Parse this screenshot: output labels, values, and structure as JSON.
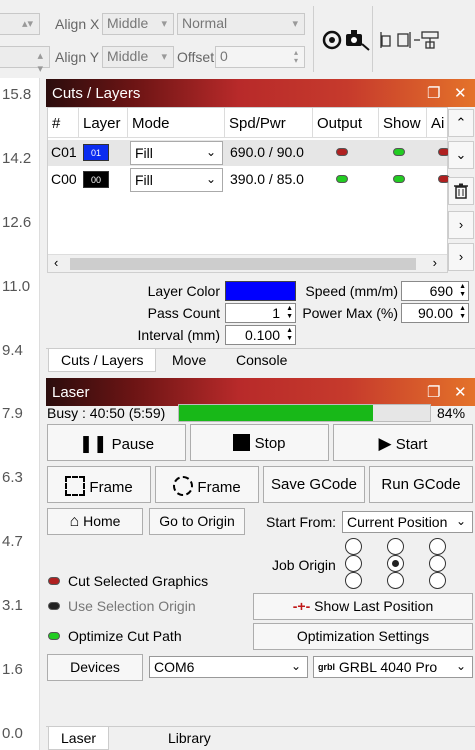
{
  "toolbar": {
    "align_x_label": "Align X",
    "align_x_value": "Middle",
    "align_x_mode": "Normal",
    "align_y_label": "Align Y",
    "align_y_value": "Middle",
    "offset_label": "Offset",
    "offset_value": "0"
  },
  "ruler": {
    "labels": [
      "15.8",
      "14.2",
      "12.6",
      "11.0",
      "9.4",
      "7.9",
      "6.3",
      "4.7",
      "3.1",
      "1.6",
      "0.0"
    ]
  },
  "cuts_panel": {
    "title": "Cuts / Layers",
    "columns": [
      "#",
      "Layer",
      "Mode",
      "Spd/Pwr",
      "Output",
      "Show",
      "Ai"
    ],
    "rows": [
      {
        "id": "C01",
        "layer": "01",
        "layer_color": "#0a2cf0",
        "mode": "Fill",
        "spd_pwr": "690.0 / 90.0",
        "output_color": "#b02020",
        "show_color": "#22cc22",
        "air_color": "#b02020"
      },
      {
        "id": "C00",
        "layer": "00",
        "layer_color": "#000000",
        "mode": "Fill",
        "spd_pwr": "390.0 / 85.0",
        "output_color": "#22cc22",
        "show_color": "#22cc22",
        "air_color": "#b02020"
      }
    ],
    "layer_color_label": "Layer Color",
    "layer_color_value": "#0000ff",
    "speed_label": "Speed (mm/m)",
    "speed_value": "690",
    "pass_count_label": "Pass Count",
    "pass_count_value": "1",
    "power_max_label": "Power Max (%)",
    "power_max_value": "90.00",
    "interval_label": "Interval (mm)",
    "interval_value": "0.100",
    "tabs": [
      "Cuts / Layers",
      "Move",
      "Console"
    ]
  },
  "laser_panel": {
    "title": "Laser",
    "status": "Busy : 40:50 (5:59)",
    "progress_percent": 84,
    "progress_label": "84%",
    "pause_label": "Pause",
    "stop_label": "Stop",
    "start_label": "Start",
    "frame1_label": "Frame",
    "frame2_label": "Frame",
    "save_gcode_label": "Save GCode",
    "run_gcode_label": "Run GCode",
    "home_label": "Home",
    "go_to_origin_label": "Go to Origin",
    "start_from_label": "Start From:",
    "start_from_value": "Current Position",
    "job_origin_label": "Job Origin",
    "cut_selected_label": "Cut Selected Graphics",
    "use_selection_origin_label": "Use Selection Origin",
    "optimize_cut_path_label": "Optimize Cut Path",
    "show_last_position_label": "Show Last Position",
    "optimization_settings_label": "Optimization Settings",
    "devices_label": "Devices",
    "port_value": "COM6",
    "device_value": "GRBL 4040 Pro",
    "device_prefix": "grbl",
    "tabs": [
      "Laser",
      "Library"
    ]
  },
  "colors": {
    "header_gradient_start": "#2b0d0d",
    "header_gradient_end": "#e4722a",
    "progress_fill": "#18b818"
  }
}
